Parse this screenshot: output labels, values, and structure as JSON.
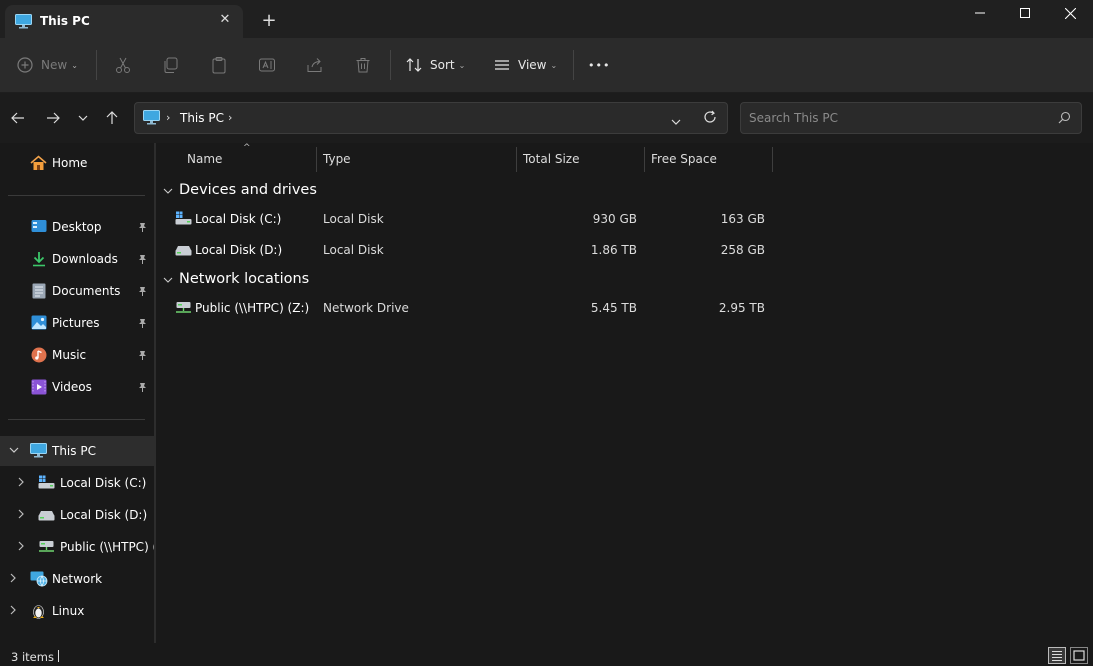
{
  "window": {
    "tab_title": "This PC",
    "tab_close": "✕",
    "new_tab": "+",
    "minimize": "—",
    "maximize": "☐",
    "close": "✕",
    "tab_icon": "monitor-icon"
  },
  "toolbar": {
    "new_label": "New",
    "sort_label": "Sort",
    "view_label": "View",
    "more_label": "•••",
    "caret": "⌄"
  },
  "address": {
    "crumb": "This PC",
    "crumb_chevron": "›",
    "search_placeholder": "Search This PC"
  },
  "nav": {
    "home": "Home",
    "quick_access": [
      {
        "label": "Desktop",
        "icon": "desktop-icon"
      },
      {
        "label": "Downloads",
        "icon": "downloads-icon"
      },
      {
        "label": "Documents",
        "icon": "documents-icon"
      },
      {
        "label": "Pictures",
        "icon": "pictures-icon"
      },
      {
        "label": "Music",
        "icon": "music-icon"
      },
      {
        "label": "Videos",
        "icon": "videos-icon"
      }
    ],
    "this_pc": "This PC",
    "drives": [
      {
        "label": "Local Disk (C:)"
      },
      {
        "label": "Local Disk (D:)"
      },
      {
        "label": "Public (\\\\HTPC) (Z:)"
      }
    ],
    "network": "Network",
    "linux": "Linux"
  },
  "columns": {
    "name": "Name",
    "type": "Type",
    "total": "Total Size",
    "free": "Free Space",
    "sort_indicator": "^"
  },
  "groups": {
    "devices": "Devices and drives",
    "network": "Network locations",
    "chevron": "⌄"
  },
  "rows": [
    {
      "name": "Local Disk (C:)",
      "type": "Local Disk",
      "total": "930 GB",
      "free": "163 GB"
    },
    {
      "name": "Local Disk (D:)",
      "type": "Local Disk",
      "total": "1.86 TB",
      "free": "258 GB"
    },
    {
      "name": "Public (\\\\HTPC) (Z:)",
      "type": "Network Drive",
      "total": "5.45 TB",
      "free": "2.95 TB"
    }
  ],
  "status": {
    "count": "3 items"
  },
  "colors": {
    "accent": "#4cc2ff",
    "background": "#191919",
    "toolbar": "#2b2b2b"
  }
}
